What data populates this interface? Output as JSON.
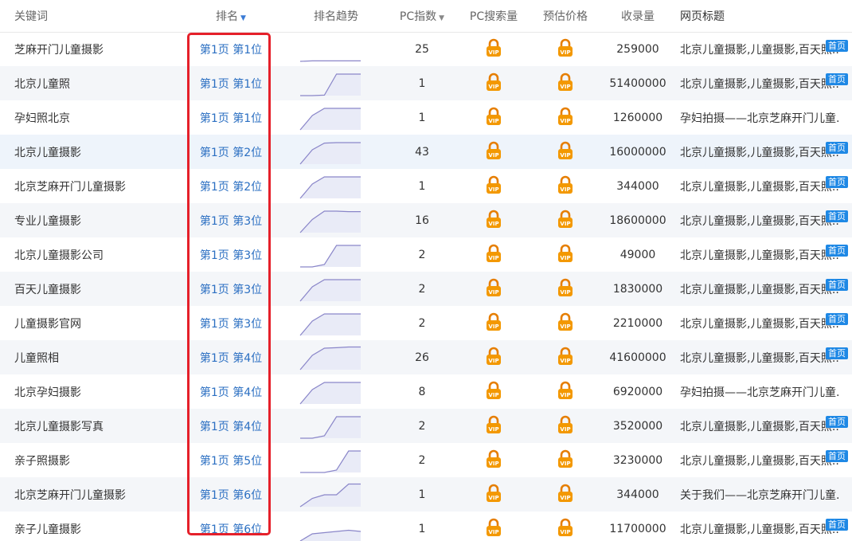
{
  "header": {
    "keyword": "关键词",
    "rank": "排名",
    "trend": "排名趋势",
    "pc_index": "PC指数",
    "pc_search": "PC搜索量",
    "price": "预估价格",
    "indexed": "收录量",
    "page_title": "网页标题"
  },
  "icons": {
    "vip_lock": "vip-lock-icon",
    "sort": "sort-down-icon"
  },
  "colors": {
    "rank_link": "#2b6fc2",
    "highlight": "#e5202a",
    "home_badge": "#1e88e5",
    "lock": "#f39800"
  },
  "rows": [
    {
      "keyword": "芝麻开门儿童摄影",
      "rank": "第1页 第1位",
      "trend": [
        0.0,
        0.02,
        0.02,
        0.02,
        0.02,
        0.02
      ],
      "pc_index": "25",
      "indexed": "259000",
      "title": "北京儿童摄影,儿童摄影,百天照...",
      "badge": "首页"
    },
    {
      "keyword": "北京儿童照",
      "rank": "第1页 第1位",
      "trend": [
        0.0,
        0.0,
        0.02,
        0.9,
        0.9,
        0.9
      ],
      "pc_index": "1",
      "indexed": "51400000",
      "title": "北京儿童摄影,儿童摄影,百天照...",
      "badge": "首页"
    },
    {
      "keyword": "孕妇照北京",
      "rank": "第1页 第1位",
      "trend": [
        0.0,
        0.6,
        0.9,
        0.9,
        0.9,
        0.9
      ],
      "pc_index": "1",
      "indexed": "1260000",
      "title": "孕妇拍摄——北京芝麻开门儿童...",
      "badge": ""
    },
    {
      "keyword": "北京儿童摄影",
      "rank": "第1页 第2位",
      "trend": [
        0.0,
        0.6,
        0.88,
        0.9,
        0.9,
        0.9
      ],
      "pc_index": "43",
      "indexed": "16000000",
      "title": "北京儿童摄影,儿童摄影,百天照...",
      "badge": "首页"
    },
    {
      "keyword": "北京芝麻开门儿童摄影",
      "rank": "第1页 第2位",
      "trend": [
        0.0,
        0.6,
        0.9,
        0.9,
        0.9,
        0.9
      ],
      "pc_index": "1",
      "indexed": "344000",
      "title": "北京儿童摄影,儿童摄影,百天照...",
      "badge": "首页"
    },
    {
      "keyword": "专业儿童摄影",
      "rank": "第1页 第3位",
      "trend": [
        0.0,
        0.55,
        0.9,
        0.9,
        0.88,
        0.88
      ],
      "pc_index": "16",
      "indexed": "18600000",
      "title": "北京儿童摄影,儿童摄影,百天照...",
      "badge": "首页"
    },
    {
      "keyword": "北京儿童摄影公司",
      "rank": "第1页 第3位",
      "trend": [
        0.0,
        0.0,
        0.1,
        0.9,
        0.9,
        0.9
      ],
      "pc_index": "2",
      "indexed": "49000",
      "title": "北京儿童摄影,儿童摄影,百天照...",
      "badge": "首页"
    },
    {
      "keyword": "百天儿童摄影",
      "rank": "第1页 第3位",
      "trend": [
        0.0,
        0.6,
        0.9,
        0.9,
        0.9,
        0.9
      ],
      "pc_index": "2",
      "indexed": "1830000",
      "title": "北京儿童摄影,儿童摄影,百天照...",
      "badge": "首页"
    },
    {
      "keyword": "儿童摄影官网",
      "rank": "第1页 第3位",
      "trend": [
        0.0,
        0.6,
        0.9,
        0.9,
        0.9,
        0.9
      ],
      "pc_index": "2",
      "indexed": "2210000",
      "title": "北京儿童摄影,儿童摄影,百天照...",
      "badge": "首页"
    },
    {
      "keyword": "儿童照相",
      "rank": "第1页 第4位",
      "trend": [
        0.0,
        0.6,
        0.9,
        0.92,
        0.95,
        0.95
      ],
      "pc_index": "26",
      "indexed": "41600000",
      "title": "北京儿童摄影,儿童摄影,百天照...",
      "badge": "首页"
    },
    {
      "keyword": "北京孕妇摄影",
      "rank": "第1页 第4位",
      "trend": [
        0.0,
        0.6,
        0.9,
        0.9,
        0.9,
        0.9
      ],
      "pc_index": "8",
      "indexed": "6920000",
      "title": "孕妇拍摄——北京芝麻开门儿童...",
      "badge": ""
    },
    {
      "keyword": "北京儿童摄影写真",
      "rank": "第1页 第4位",
      "trend": [
        0.0,
        0.0,
        0.1,
        0.9,
        0.9,
        0.9
      ],
      "pc_index": "2",
      "indexed": "3520000",
      "title": "北京儿童摄影,儿童摄影,百天照...",
      "badge": "首页"
    },
    {
      "keyword": "亲子照摄影",
      "rank": "第1页 第5位",
      "trend": [
        0.0,
        0.0,
        0.0,
        0.1,
        0.9,
        0.9
      ],
      "pc_index": "2",
      "indexed": "3230000",
      "title": "北京儿童摄影,儿童摄影,百天照...",
      "badge": "首页"
    },
    {
      "keyword": "北京芝麻开门儿童摄影",
      "rank": "第1页 第6位",
      "trend": [
        0.0,
        0.35,
        0.5,
        0.5,
        0.95,
        0.95
      ],
      "pc_index": "1",
      "indexed": "344000",
      "title": "关于我们——北京芝麻开门儿童...",
      "badge": ""
    },
    {
      "keyword": "亲子儿童摄影",
      "rank": "第1页 第6位",
      "trend": [
        0.0,
        0.3,
        0.35,
        0.4,
        0.45,
        0.4
      ],
      "pc_index": "1",
      "indexed": "11700000",
      "title": "北京儿童摄影,儿童摄影,百天照...",
      "badge": "首页"
    }
  ]
}
